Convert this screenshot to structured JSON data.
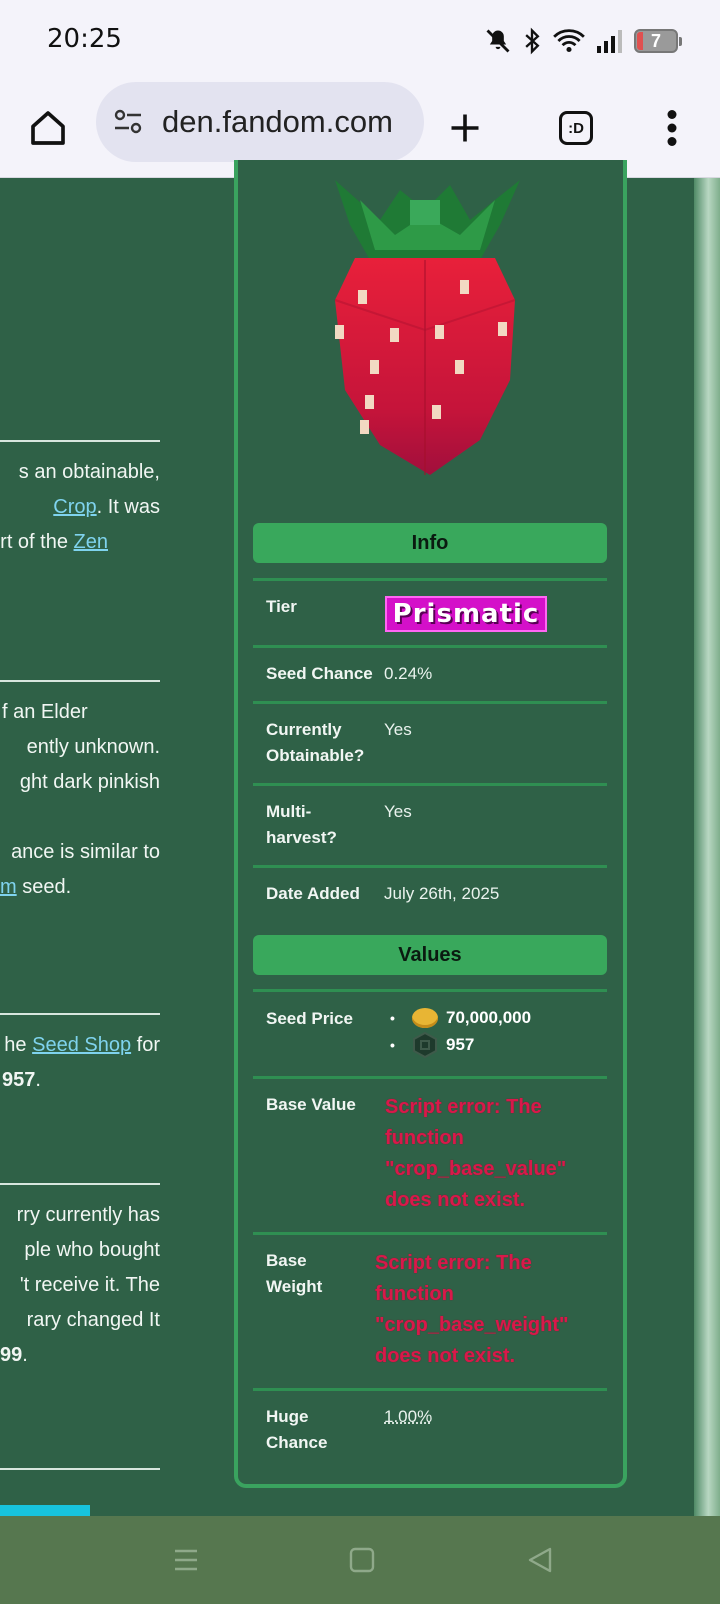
{
  "status": {
    "time": "20:25",
    "battery": "7"
  },
  "browser": {
    "url": "den.fandom.com",
    "tabs_label": ":D"
  },
  "article": {
    "p1": [
      "s an obtainable,",
      "Crop",
      ". It was",
      "rt of the ",
      "Zen"
    ],
    "p2": [
      "f an Elder",
      "ently unknown.",
      "ght dark pinkish",
      "ance is similar to",
      "m",
      " seed."
    ],
    "p3": [
      "he ",
      "Seed Shop",
      " for",
      "957",
      "."
    ],
    "p4": [
      "rry currently has",
      "ple who bought",
      "'t receive it. The",
      "rary changed It",
      "99",
      "."
    ]
  },
  "infobox": {
    "info_heading": "Info",
    "values_heading": "Values",
    "tier_label": "Tier",
    "tier_value": "Prismatic",
    "seed_chance_label": "Seed Chance",
    "seed_chance_value": "0.24%",
    "obtainable_label_1": "Currently",
    "obtainable_label_2": "Obtainable?",
    "obtainable_value": "Yes",
    "multi_label_1": "Multi-",
    "multi_label_2": "harvest?",
    "multi_value": "Yes",
    "date_label": "Date Added",
    "date_value": "July 26th, 2025",
    "seed_price_label": "Seed Price",
    "seed_price_sheckles": "70,000,000",
    "seed_price_robux": "957",
    "base_value_label": "Base Value",
    "base_value_error": [
      "Script error: The",
      "function",
      "\"crop_base_value\"",
      "does not exist."
    ],
    "base_weight_label_1": "Base",
    "base_weight_label_2": "Weight",
    "base_weight_error": [
      "Script error: The",
      "function",
      "\"crop_base_weight\"",
      "does not exist."
    ],
    "huge_label_1": "Huge",
    "huge_label_2": "Chance",
    "huge_value": "1.00%"
  },
  "icons": [
    "home-icon",
    "site-settings-icon",
    "new-tab-icon",
    "tabs-icon",
    "more-vert-icon",
    "mute-icon",
    "bluetooth-icon",
    "wifi-icon",
    "signal-icon",
    "battery-icon",
    "menu-icon",
    "home-square-icon",
    "back-icon",
    "coin-icon",
    "robux-icon"
  ],
  "colors": {
    "page_bg": "#2f6147",
    "accent_green": "#39a85c",
    "link": "#7fd3ee",
    "error": "#d8194a",
    "prismatic": "#d410c9"
  }
}
